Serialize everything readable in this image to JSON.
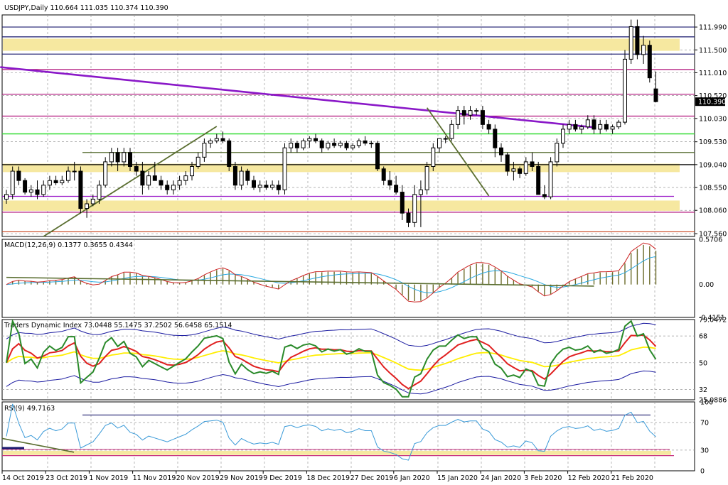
{
  "colors": {
    "background": "#ffffff",
    "frame": "#000000",
    "grid": "#9a9a9a",
    "zone_fill": "#f6e8a0",
    "level_navy": "#1a1a6e",
    "level_magenta": "#b0107a",
    "level_purple": "#9a18c8",
    "level_green": "#33dd33",
    "level_olive": "#556b2f",
    "level_red": "#c8401a",
    "level_black": "#000000",
    "trend_purple": "#8a18c8",
    "trend_olive": "#5a6e30",
    "candle_body": "#000000",
    "price_label_bg": "#000000",
    "price_label_fg": "#ffffff",
    "macd_hist": "#6b6b2a",
    "macd_signal": "#cc2020",
    "macd_line": "#28a8e0",
    "tdi_band": "#1a1aa0",
    "tdi_mid": "#ffee00",
    "tdi_green": "#2a8a2a",
    "tdi_red": "#e02020",
    "rsi_line": "#3a9ad8",
    "rsi_level": "#1a1a6e",
    "rsi_zone_line": "#c83080"
  },
  "header": {
    "title": "USDJPY,Daily  110.664 111.035 110.374 110.390"
  },
  "price_axis": {
    "ticks": [
      "111.990",
      "111.500",
      "111.010",
      "110.520",
      "110.030",
      "109.530",
      "109.040",
      "108.550",
      "108.060",
      "107.560"
    ],
    "current_label": "110.390"
  },
  "date_axis": {
    "labels": [
      "14 Oct 2019",
      "23 Oct 2019",
      "1 Nov 2019",
      "11 Nov 2019",
      "20 Nov 2019",
      "29 Nov 2019",
      "9 Dec 2019",
      "18 Dec 2019",
      "27 Dec 2019",
      "6 Jan 2020",
      "15 Jan 2020",
      "24 Jan 2020",
      "3 Feb 2020",
      "12 Feb 2020",
      "21 Feb 2020"
    ]
  },
  "macd": {
    "title": "MACD(12,26,9) 0.1377 0.3655 0.4344",
    "ticks": [
      "0.5706",
      "0.00",
      "-0.4151"
    ]
  },
  "tdi": {
    "title": "Traders Dynamic Index 73.0448 55.1475 37.2502 56.6458 65.1514",
    "ticks": [
      "79.0472",
      "68",
      "50",
      "32",
      "25.0886"
    ]
  },
  "rsi": {
    "title": "RSI(9) 49.7163",
    "ticks": [
      "100",
      "70",
      "30",
      "0"
    ]
  },
  "chart_data": {
    "type": "candlestick",
    "symbol": "USDJPY",
    "timeframe": "Daily",
    "last_bar": {
      "open": 110.664,
      "high": 111.035,
      "low": 110.374,
      "close": 110.39
    },
    "ylim": [
      107.5,
      112.25
    ],
    "horizontal_levels": [
      {
        "price": 111.99,
        "color": "navy"
      },
      {
        "price": 111.78,
        "color": "navy"
      },
      {
        "price": 111.41,
        "color": "navy"
      },
      {
        "price": 111.08,
        "color": "magenta"
      },
      {
        "price": 110.55,
        "color": "magenta"
      },
      {
        "price": 110.08,
        "color": "magenta"
      },
      {
        "price": 109.7,
        "color": "green"
      },
      {
        "price": 109.3,
        "color": "olive"
      },
      {
        "price": 109.04,
        "color": "black"
      },
      {
        "price": 108.36,
        "color": "purple"
      },
      {
        "price": 108.02,
        "color": "magenta"
      },
      {
        "price": 107.6,
        "color": "red"
      }
    ],
    "zones": [
      {
        "from": 111.48,
        "to": 111.74
      },
      {
        "from": 108.88,
        "to": 109.06
      },
      {
        "from": 108.05,
        "to": 108.27
      }
    ],
    "trendlines": [
      {
        "color": "purple",
        "from": {
          "bar": -1,
          "price": 111.13
        },
        "to": {
          "bar": 95,
          "price": 109.84
        }
      },
      {
        "color": "olive",
        "from": {
          "bar": 6,
          "price": 107.5
        },
        "to": {
          "bar": 34,
          "price": 109.86
        }
      },
      {
        "color": "olive",
        "from": {
          "bar": 68,
          "price": 110.26
        },
        "to": {
          "bar": 78,
          "price": 108.37
        }
      }
    ],
    "candles": [
      [
        108.3,
        108.5,
        108.2,
        108.4
      ],
      [
        108.4,
        109.0,
        108.3,
        108.9
      ],
      [
        108.9,
        109.0,
        108.6,
        108.7
      ],
      [
        108.7,
        108.75,
        108.4,
        108.45
      ],
      [
        108.45,
        108.6,
        108.35,
        108.5
      ],
      [
        108.5,
        108.7,
        108.3,
        108.4
      ],
      [
        108.4,
        108.7,
        108.35,
        108.6
      ],
      [
        108.6,
        108.8,
        108.5,
        108.7
      ],
      [
        108.7,
        108.8,
        108.6,
        108.65
      ],
      [
        108.65,
        108.8,
        108.6,
        108.7
      ],
      [
        108.7,
        109.0,
        108.65,
        108.9
      ],
      [
        108.9,
        109.1,
        108.7,
        108.9
      ],
      [
        108.9,
        109.0,
        108.0,
        108.1
      ],
      [
        108.1,
        108.3,
        107.9,
        108.2
      ],
      [
        108.2,
        108.4,
        108.15,
        108.3
      ],
      [
        108.3,
        108.7,
        108.2,
        108.6
      ],
      [
        108.6,
        109.2,
        108.55,
        109.1
      ],
      [
        109.1,
        109.4,
        109.0,
        109.3
      ],
      [
        109.3,
        109.4,
        108.9,
        109.1
      ],
      [
        109.1,
        109.4,
        109.0,
        109.3
      ],
      [
        109.3,
        109.4,
        108.9,
        109.0
      ],
      [
        109.0,
        109.1,
        108.8,
        108.9
      ],
      [
        108.9,
        109.1,
        108.4,
        108.6
      ],
      [
        108.6,
        108.9,
        108.5,
        108.8
      ],
      [
        108.8,
        109.1,
        108.7,
        108.7
      ],
      [
        108.7,
        108.8,
        108.5,
        108.6
      ],
      [
        108.6,
        108.7,
        108.4,
        108.5
      ],
      [
        108.5,
        108.7,
        108.4,
        108.6
      ],
      [
        108.6,
        108.8,
        108.5,
        108.7
      ],
      [
        108.7,
        108.9,
        108.6,
        108.8
      ],
      [
        108.8,
        109.1,
        108.7,
        109.0
      ],
      [
        109.0,
        109.3,
        108.95,
        109.2
      ],
      [
        109.2,
        109.6,
        109.1,
        109.5
      ],
      [
        109.5,
        109.6,
        109.4,
        109.55
      ],
      [
        109.55,
        109.7,
        109.5,
        109.6
      ],
      [
        109.6,
        109.75,
        109.5,
        109.55
      ],
      [
        109.55,
        109.6,
        108.9,
        109.0
      ],
      [
        109.0,
        109.1,
        108.5,
        108.6
      ],
      [
        108.6,
        109.0,
        108.5,
        108.9
      ],
      [
        108.9,
        108.95,
        108.6,
        108.7
      ],
      [
        108.7,
        108.8,
        108.5,
        108.55
      ],
      [
        108.55,
        108.7,
        108.45,
        108.6
      ],
      [
        108.6,
        108.7,
        108.5,
        108.55
      ],
      [
        108.55,
        108.7,
        108.5,
        108.6
      ],
      [
        108.6,
        108.7,
        108.4,
        108.5
      ],
      [
        108.5,
        109.5,
        108.4,
        109.4
      ],
      [
        109.4,
        109.6,
        109.3,
        109.5
      ],
      [
        109.5,
        109.55,
        109.3,
        109.4
      ],
      [
        109.4,
        109.6,
        109.35,
        109.55
      ],
      [
        109.55,
        109.65,
        109.4,
        109.6
      ],
      [
        109.6,
        109.7,
        109.5,
        109.55
      ],
      [
        109.55,
        109.6,
        109.3,
        109.4
      ],
      [
        109.4,
        109.55,
        109.35,
        109.5
      ],
      [
        109.5,
        109.6,
        109.4,
        109.45
      ],
      [
        109.45,
        109.55,
        109.4,
        109.5
      ],
      [
        109.5,
        109.55,
        109.35,
        109.4
      ],
      [
        109.4,
        109.5,
        109.35,
        109.45
      ],
      [
        109.45,
        109.6,
        109.4,
        109.55
      ],
      [
        109.55,
        109.65,
        109.45,
        109.5
      ],
      [
        109.5,
        109.55,
        109.4,
        109.5
      ],
      [
        109.5,
        109.55,
        108.9,
        108.95
      ],
      [
        108.95,
        109.0,
        108.6,
        108.7
      ],
      [
        108.7,
        108.9,
        108.5,
        108.6
      ],
      [
        108.6,
        108.8,
        108.4,
        108.45
      ],
      [
        108.45,
        108.6,
        107.85,
        108.0
      ],
      [
        108.0,
        108.1,
        107.7,
        107.8
      ],
      [
        107.8,
        108.6,
        107.7,
        108.4
      ],
      [
        108.4,
        108.7,
        107.7,
        108.5
      ],
      [
        108.5,
        109.1,
        108.4,
        109.0
      ],
      [
        109.0,
        109.5,
        108.9,
        109.4
      ],
      [
        109.4,
        109.6,
        109.3,
        109.6
      ],
      [
        109.6,
        109.65,
        109.5,
        109.6
      ],
      [
        109.6,
        110.0,
        109.55,
        109.9
      ],
      [
        109.9,
        110.3,
        109.8,
        110.2
      ],
      [
        110.2,
        110.3,
        109.9,
        110.1
      ],
      [
        110.1,
        110.3,
        110.0,
        110.2
      ],
      [
        110.2,
        110.25,
        110.1,
        110.2
      ],
      [
        110.2,
        110.3,
        109.8,
        109.9
      ],
      [
        109.9,
        110.0,
        109.7,
        109.8
      ],
      [
        109.8,
        109.9,
        109.2,
        109.4
      ],
      [
        109.4,
        109.5,
        109.1,
        109.25
      ],
      [
        109.25,
        109.3,
        108.8,
        108.9
      ],
      [
        108.9,
        109.1,
        108.7,
        108.95
      ],
      [
        108.95,
        109.0,
        108.75,
        108.85
      ],
      [
        108.85,
        109.2,
        108.8,
        109.1
      ],
      [
        109.1,
        109.3,
        108.9,
        109.0
      ],
      [
        109.0,
        109.1,
        108.4,
        108.4
      ],
      [
        108.4,
        108.6,
        108.3,
        108.35
      ],
      [
        108.35,
        109.2,
        108.3,
        109.1
      ],
      [
        109.1,
        109.6,
        109.0,
        109.5
      ],
      [
        109.5,
        109.9,
        109.4,
        109.8
      ],
      [
        109.8,
        110.0,
        109.7,
        109.9
      ],
      [
        109.9,
        110.0,
        109.75,
        109.8
      ],
      [
        109.8,
        109.9,
        109.7,
        109.85
      ],
      [
        109.85,
        110.1,
        109.8,
        110.0
      ],
      [
        110.0,
        110.1,
        109.7,
        109.8
      ],
      [
        109.8,
        110.0,
        109.7,
        109.9
      ],
      [
        109.9,
        110.0,
        109.75,
        109.8
      ],
      [
        109.8,
        109.9,
        109.7,
        109.85
      ],
      [
        109.85,
        110.0,
        109.8,
        109.95
      ],
      [
        109.95,
        111.5,
        109.9,
        111.3
      ],
      [
        111.3,
        112.15,
        111.2,
        112.0
      ],
      [
        112.0,
        112.15,
        111.3,
        111.4
      ],
      [
        111.4,
        111.8,
        111.2,
        111.6
      ],
      [
        111.6,
        111.7,
        110.8,
        110.9
      ],
      [
        110.664,
        111.035,
        110.374,
        110.39
      ]
    ],
    "indicators": {
      "macd": {
        "params": "12,26,9",
        "values": [
          0.1377,
          0.3655,
          0.4344
        ],
        "range": [
          -0.4151,
          0.5706
        ]
      },
      "traders_dynamic_index": {
        "values": [
          73.0448,
          55.1475,
          37.2502,
          56.6458,
          65.1514
        ],
        "levels": [
          68,
          50,
          32
        ],
        "range": [
          25.0886,
          79.0472
        ]
      },
      "rsi": {
        "period": 9,
        "value": 49.7163,
        "levels": [
          70,
          30
        ],
        "range": [
          0,
          100
        ]
      }
    }
  }
}
